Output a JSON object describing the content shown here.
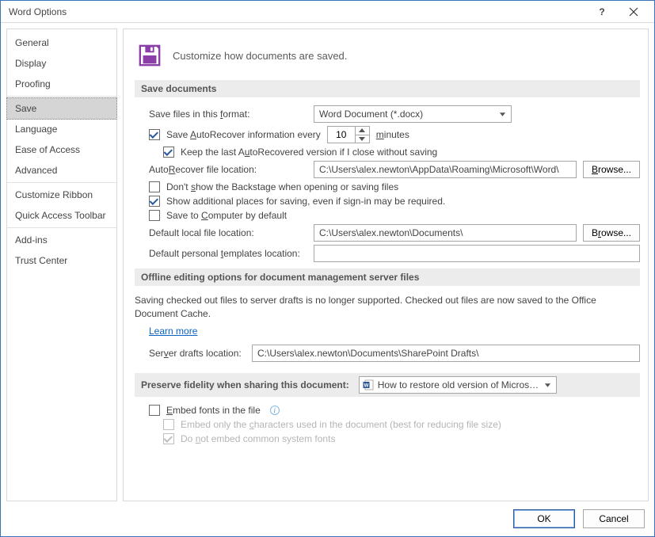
{
  "window": {
    "title": "Word Options"
  },
  "sidebar": {
    "items": [
      {
        "label": "General"
      },
      {
        "label": "Display"
      },
      {
        "label": "Proofing"
      },
      {
        "label": "Save",
        "selected": true
      },
      {
        "label": "Language"
      },
      {
        "label": "Ease of Access"
      },
      {
        "label": "Advanced"
      },
      {
        "label": "Customize Ribbon"
      },
      {
        "label": "Quick Access Toolbar"
      },
      {
        "label": "Add-ins"
      },
      {
        "label": "Trust Center"
      }
    ],
    "separators_after": [
      2,
      6,
      8
    ]
  },
  "header": {
    "text": "Customize how documents are saved."
  },
  "save_section": {
    "title": "Save documents",
    "format_label_pre": "Save files in this ",
    "format_label_u": "f",
    "format_label_post": "ormat:",
    "format_value": "Word Document (*.docx)",
    "autorecover": {
      "checked": true,
      "pre": "Save ",
      "u": "A",
      "post": "utoRecover information every",
      "value": "10",
      "unit_u": "m",
      "unit_post": "inutes"
    },
    "keep_last": {
      "checked": true,
      "pre": "Keep the last A",
      "u": "u",
      "post": "toRecovered version if I close without saving"
    },
    "ar_loc": {
      "label_pre": "Auto",
      "label_u": "R",
      "label_post": "ecover file location:",
      "value": "C:\\Users\\alex.newton\\AppData\\Roaming\\Microsoft\\Word\\",
      "browse_u": "B",
      "browse_post": "rowse..."
    },
    "no_backstage": {
      "checked": false,
      "pre": "Don't ",
      "u": "s",
      "post": "how the Backstage when opening or saving files"
    },
    "show_additional": {
      "checked": true,
      "text": "Show additional places for saving, even if sign-in may be required."
    },
    "save_to_computer": {
      "checked": false,
      "pre": "Save to ",
      "u": "C",
      "post": "omputer by default"
    },
    "default_loc": {
      "label_pre": "Default local file location:",
      "label_u": "",
      "value": "C:\\Users\\alex.newton\\Documents\\",
      "browse_pre": "B",
      "browse_u": "r",
      "browse_post": "owse..."
    },
    "templates_loc": {
      "label_pre": "Default personal ",
      "label_u": "t",
      "label_post": "emplates location:",
      "value": ""
    }
  },
  "offline_section": {
    "title": "Offline editing options for document management server files",
    "body": "Saving checked out files to server drafts is no longer supported. Checked out files are now saved to the Office Document Cache.",
    "link": "Learn more",
    "drafts": {
      "label_pre": "Ser",
      "label_u": "v",
      "label_post": "er drafts location:",
      "value": "C:\\Users\\alex.newton\\Documents\\SharePoint Drafts\\"
    }
  },
  "preserve_section": {
    "title": "Preserve fidelity when sharing this document:",
    "doc_value": "How to restore old version of Microso...",
    "embed": {
      "checked": false,
      "u": "E",
      "post": "mbed fonts in the file"
    },
    "embed_chars": {
      "disabled": true,
      "checked": false,
      "pre": "Embed only the ",
      "u": "c",
      "post": "haracters used in the document (best for reducing file size)"
    },
    "no_common": {
      "disabled": true,
      "checked": true,
      "pre": "Do ",
      "u": "n",
      "post": "ot embed common system fonts"
    }
  },
  "footer": {
    "ok": "OK",
    "cancel": "Cancel"
  }
}
